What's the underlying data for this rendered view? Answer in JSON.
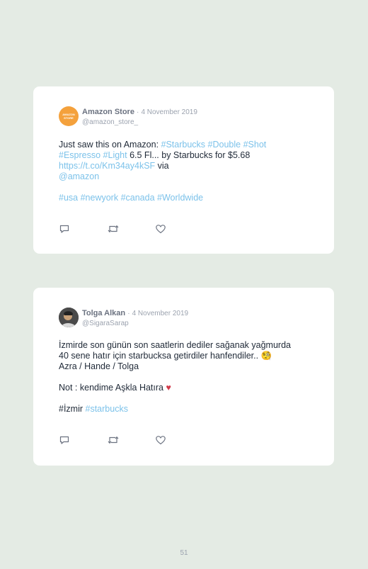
{
  "tweets": [
    {
      "avatar_icon": "amazon-store-logo",
      "avatar_text": "AMAZON STORE",
      "name": "Amazon Store",
      "separator": "·",
      "date": "4 November 2019",
      "handle": "@amazon_store_",
      "text_parts": {
        "p1": "Just saw this on Amazon: ",
        "l1": "#Starbucks",
        "p2": " ",
        "l2": "#Double",
        "p3": " ",
        "l3": "#Shot",
        "p4": "\n",
        "l4": "#Espresso",
        "p5": " ",
        "l5": "#Light",
        "p6": " 6.5 Fl... by Starbucks for $5.68\n",
        "l6": "https://t.co/Km34ay4kSF",
        "p7": " via\n",
        "l7": "@amazon",
        "p8": "\n\n",
        "l8": "#usa",
        "p9": " ",
        "l9": "#newyork",
        "p10": " ",
        "l10": "#canada",
        "p11": " ",
        "l11": "#Worldwide"
      }
    },
    {
      "avatar_icon": "profile-photo",
      "name": "Tolga Alkan",
      "separator": "·",
      "date": "4 November 2019",
      "handle": "@SigaraSarap",
      "text_parts": {
        "p1": "İzmirde son günün son saatlerin dediler sağanak yağmurda\n40 sene hatır için starbucksa getirdiler hanfendiler.. ",
        "emoji1": "🧐",
        "p2": "\nAzra / Hande / Tolga\n\nNot : kendime Aşkla Hatıra ",
        "emoji2": "♥",
        "p3": "\n\n#İzmir ",
        "l1": "#starbucks"
      }
    }
  ],
  "actions": [
    "reply-icon",
    "retweet-icon",
    "like-icon"
  ],
  "colors": {
    "link": "#7cc2ea",
    "background": "#e4ebe4",
    "card": "#ffffff",
    "heart": "#d23a4a"
  },
  "page_number": "51"
}
